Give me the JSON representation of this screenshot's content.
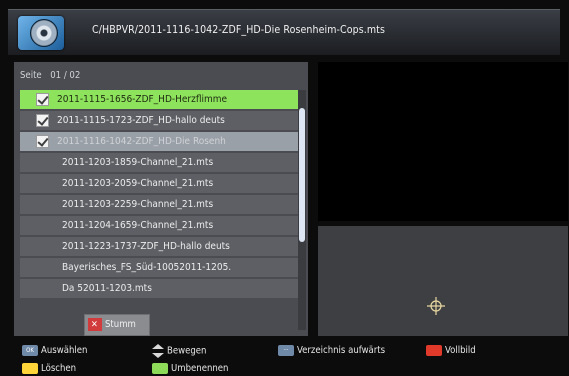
{
  "header": {
    "path": "C/HBPVR/2011-1116-1042-ZDF_HD-Die Rosenheim-Cops.mts"
  },
  "list": {
    "page_label": "Seite",
    "page_number": "01 / 02",
    "rows": [
      {
        "label": "2011-1115-1656-ZDF_HD-Herzflimme",
        "checked": true,
        "state": "active"
      },
      {
        "label": "2011-1115-1723-ZDF_HD-hallo deuts",
        "checked": true,
        "state": "normal"
      },
      {
        "label": "2011-1116-1042-ZDF_HD-Die Rosenh",
        "checked": true,
        "state": "dim"
      },
      {
        "label": "2011-1203-1859-Channel_21.mts",
        "checked": false,
        "state": "normal"
      },
      {
        "label": "2011-1203-2059-Channel_21.mts",
        "checked": false,
        "state": "normal"
      },
      {
        "label": "2011-1203-2259-Channel_21.mts",
        "checked": false,
        "state": "normal"
      },
      {
        "label": "2011-1204-1659-Channel_21.mts",
        "checked": false,
        "state": "normal"
      },
      {
        "label": "2011-1223-1737-ZDF_HD-hallo deuts",
        "checked": false,
        "state": "normal"
      },
      {
        "label": "Bayerisches_FS_Süd-10052011-1205.",
        "checked": false,
        "state": "normal"
      },
      {
        "label": "Da                  52011-1203.mts",
        "checked": false,
        "state": "normal"
      }
    ],
    "mute_label": "Stumm"
  },
  "legend": {
    "ok_key": "OK",
    "select_label": "Auswählen",
    "move_label": "Bewegen",
    "file_key": "···",
    "up_label": "Verzeichnis aufwärts",
    "fullscreen_label": "Vollbild",
    "delete_label": "Löschen",
    "rename_label": "Umbenennen",
    "colors": {
      "red": "#e23a2a",
      "yellow": "#ffd53a",
      "green": "#8edb5a",
      "highlight": "#8ee35c"
    }
  }
}
